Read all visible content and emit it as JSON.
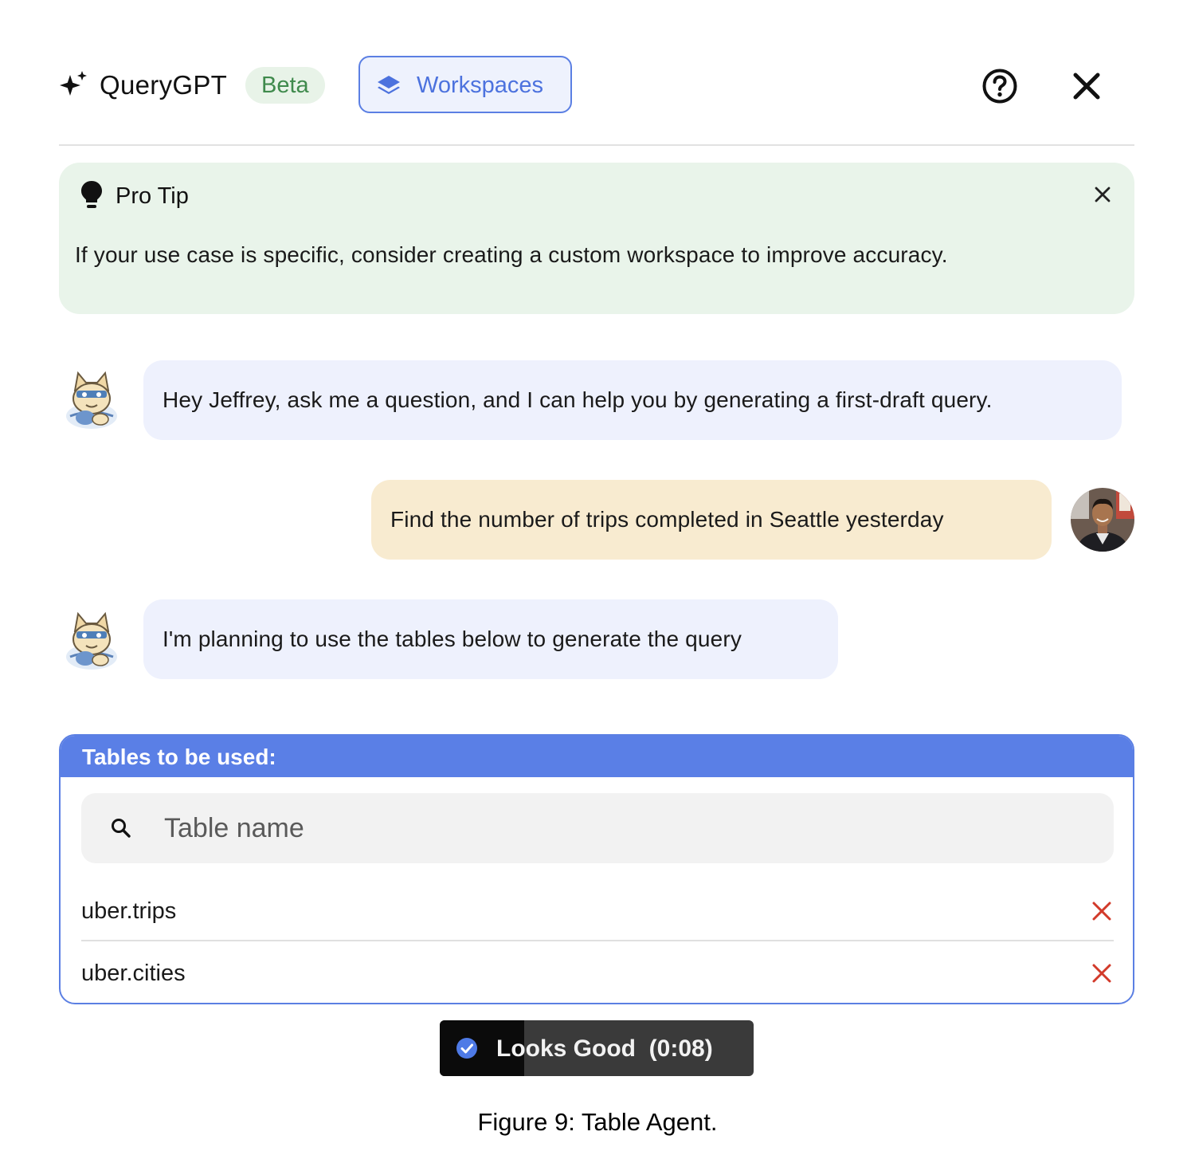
{
  "header": {
    "app_name": "QueryGPT",
    "badge": "Beta",
    "workspaces_label": "Workspaces",
    "accent_color": "#5b7fe3"
  },
  "pro_tip": {
    "title": "Pro Tip",
    "text": "If your use case is specific, consider creating a custom workspace to improve accuracy."
  },
  "chat": {
    "messages": [
      {
        "sender": "bot",
        "text": "Hey Jeffrey, ask me a question, and I can help you by generating a first-draft query."
      },
      {
        "sender": "user",
        "text": "Find the number of trips completed in Seattle yesterday"
      },
      {
        "sender": "bot",
        "text": "I'm planning to use the tables below to generate the query"
      }
    ]
  },
  "tables_panel": {
    "title": "Tables to be used:",
    "search_placeholder": "Table name",
    "tables": [
      {
        "name": "uber.trips"
      },
      {
        "name": "uber.cities"
      }
    ]
  },
  "confirm": {
    "label": "Looks Good",
    "timer": "(0:08)",
    "countdown_progress": 0.27
  },
  "caption": "Figure 9: Table Agent."
}
